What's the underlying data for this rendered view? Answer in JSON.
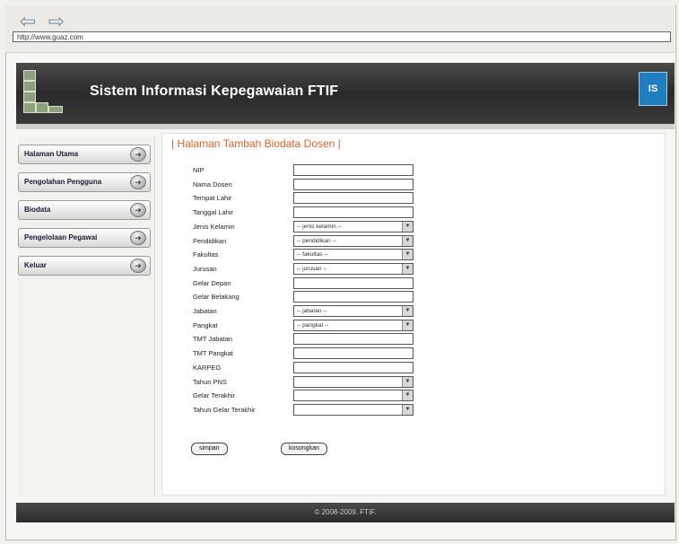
{
  "browser": {
    "back_icon": "back-arrow-icon",
    "forward_icon": "forward-arrow-icon",
    "url": "http://www.guaz.com"
  },
  "header": {
    "title": "Sistem Informasi Kepegawaian FTIF",
    "badge_text": "IS"
  },
  "sidebar": {
    "items": [
      {
        "label": "Halaman Utama"
      },
      {
        "label": "Pengolahan Pengguna"
      },
      {
        "label": "Biodata"
      },
      {
        "label": "Pengelolaan Pegawai"
      },
      {
        "label": "Keluar"
      }
    ]
  },
  "main": {
    "title": "| Halaman Tambah Biodata Dosen |",
    "fields": [
      {
        "label": "NIP",
        "type": "input",
        "value": ""
      },
      {
        "label": "Nama Dosen",
        "type": "input",
        "value": ""
      },
      {
        "label": "Tempat Lahir",
        "type": "input",
        "value": ""
      },
      {
        "label": "Tanggal Lahir",
        "type": "input",
        "value": ""
      },
      {
        "label": "Jenis Kelamin",
        "type": "select",
        "value": "-- jenis kelamin --"
      },
      {
        "label": "Pendidikan",
        "type": "select",
        "value": "-- pendidikan --"
      },
      {
        "label": "Fakultas",
        "type": "select",
        "value": "-- fakultas --"
      },
      {
        "label": "Jurusan",
        "type": "select",
        "value": "-- jurusan --"
      },
      {
        "label": "Gelar Depan",
        "type": "input",
        "value": ""
      },
      {
        "label": "Gelar Belakang",
        "type": "input",
        "value": ""
      },
      {
        "label": "Jabatan",
        "type": "select",
        "value": "-- jabatan --"
      },
      {
        "label": "Pangkat",
        "type": "select",
        "value": "-- pangkat --"
      },
      {
        "label": "TMT Jabatan",
        "type": "input",
        "value": ""
      },
      {
        "label": "TMT Pangkat",
        "type": "input",
        "value": ""
      },
      {
        "label": "KARPEG",
        "type": "input",
        "value": ""
      },
      {
        "label": "Tahun PNS",
        "type": "select",
        "value": ""
      },
      {
        "label": "Gelar Terakhir",
        "type": "select",
        "value": ""
      },
      {
        "label": "Tahun Gelar Terakhir",
        "type": "select",
        "value": ""
      }
    ],
    "buttons": {
      "save": "simpan",
      "clear": "kosongkan"
    }
  },
  "footer": {
    "text": "© 2008-2009. FTIF."
  }
}
